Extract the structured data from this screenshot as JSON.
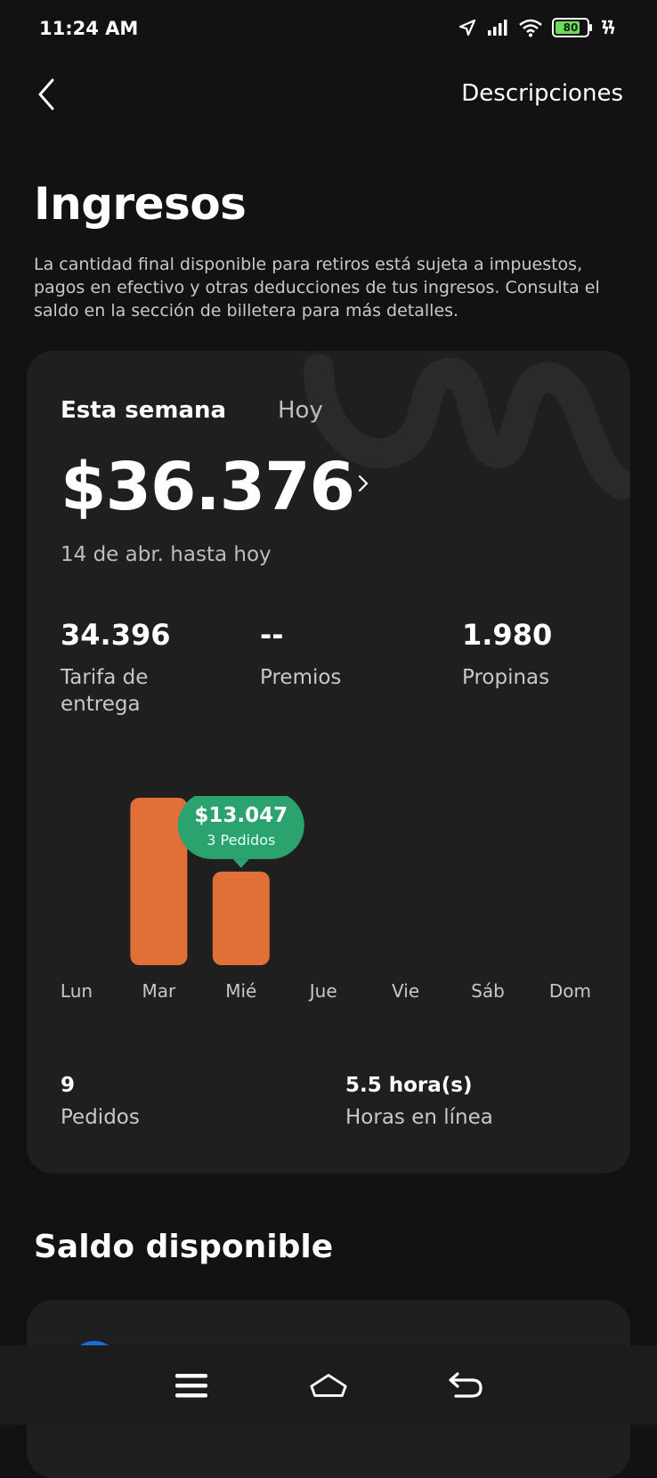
{
  "status_bar": {
    "time": "11:24 AM",
    "battery": "80"
  },
  "header": {
    "back_icon": "chevron-left-icon",
    "descriptions_link": "Descripciones"
  },
  "page": {
    "title": "Ingresos",
    "description": "La cantidad final disponible para retiros está sujeta a impuestos, pagos en efectivo y otras deducciones de tus ingresos. Consulta el saldo en la sección de billetera para más detalles."
  },
  "earnings_card": {
    "tabs": {
      "week": "Esta semana",
      "today": "Hoy"
    },
    "active_tab": "week",
    "total": "$36.376",
    "period": "14 de abr. hasta hoy",
    "metrics": [
      {
        "value": "34.396",
        "label": "Tarifa de entrega"
      },
      {
        "value": "--",
        "label": "Premios"
      },
      {
        "value": "1.980",
        "label": "Propinas"
      }
    ],
    "tooltip": {
      "amount": "$13.047",
      "orders": "3 Pedidos"
    },
    "footer": [
      {
        "value": "9",
        "label": "Pedidos"
      },
      {
        "value": "5.5 hora(s)",
        "label": "Horas en línea"
      }
    ]
  },
  "chart_data": {
    "type": "bar",
    "categories": [
      "Lun",
      "Mar",
      "Mié",
      "Jue",
      "Vie",
      "Sáb",
      "Dom"
    ],
    "values": [
      0,
      23329,
      13047,
      0,
      0,
      0,
      0
    ],
    "selected_index": 2,
    "bar_color": "#e07038",
    "tooltip_color": "#2aa36f"
  },
  "balance_section": {
    "title": "Saldo disponible"
  },
  "colors": {
    "background": "#121212",
    "card": "#1f1f1f",
    "accent_orange": "#e07038",
    "accent_green": "#2aa36f"
  },
  "navbar": {
    "menu_icon": "menu-icon",
    "home_icon": "home-icon",
    "back_icon": "back-arrow-icon"
  }
}
